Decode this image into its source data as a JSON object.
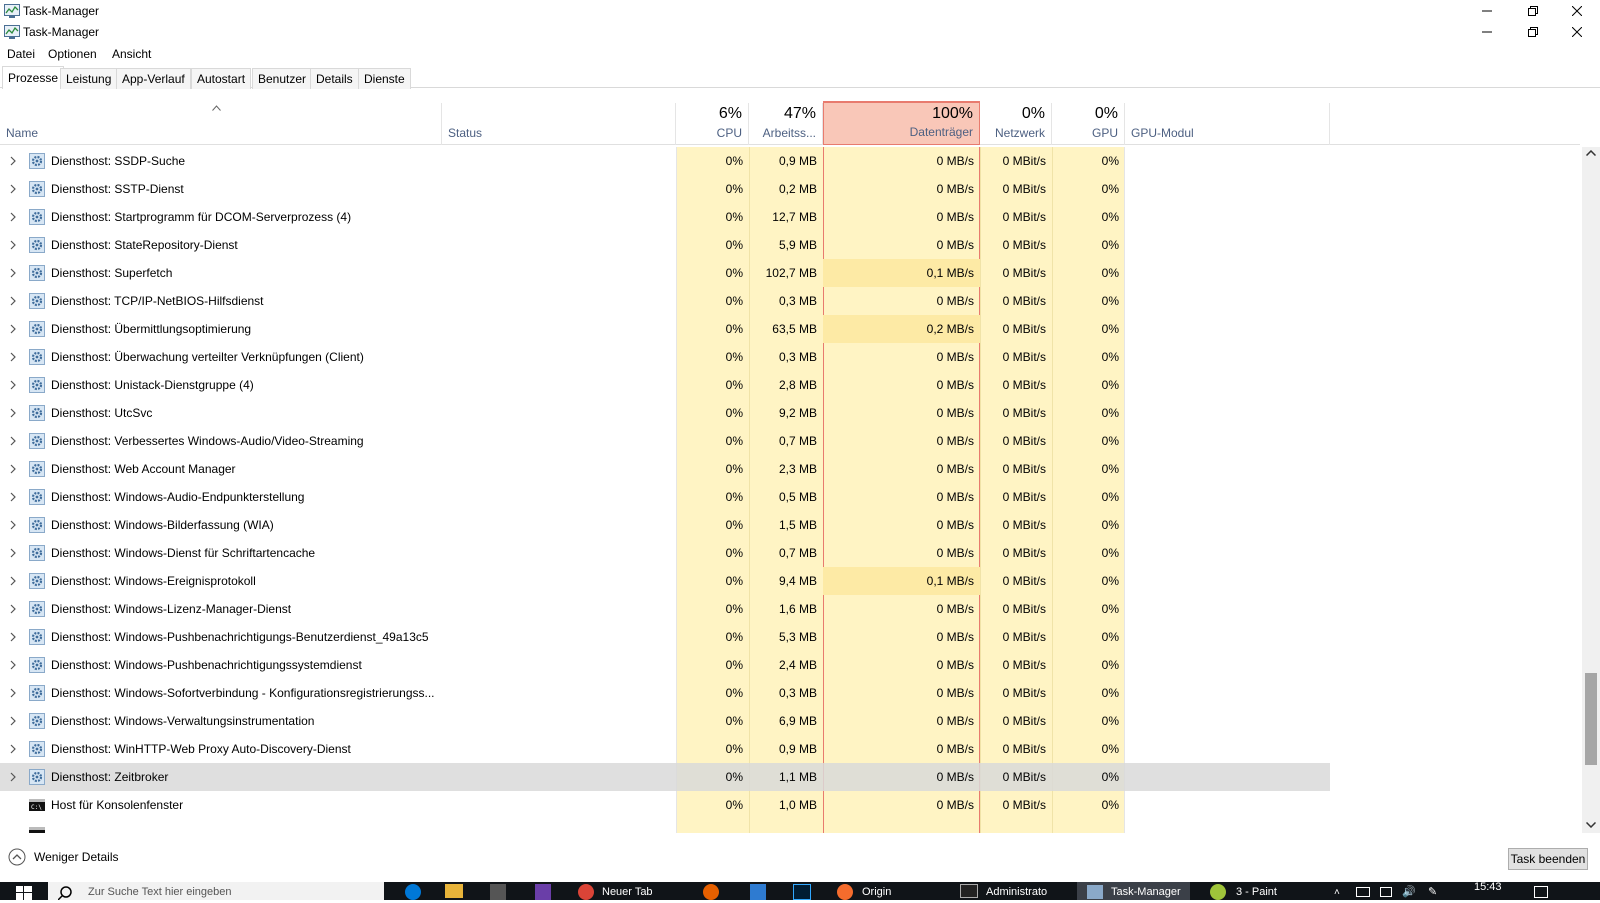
{
  "window": {
    "title": "Task-Manager"
  },
  "menu": [
    "Datei",
    "Optionen",
    "Ansicht"
  ],
  "tabs": [
    "Prozesse",
    "Leistung",
    "App-Verlauf",
    "Autostart",
    "Benutzer",
    "Details",
    "Dienste"
  ],
  "columns": {
    "name": "Name",
    "status": "Status",
    "cpu": {
      "pct": "6%",
      "label": "CPU"
    },
    "mem": {
      "pct": "47%",
      "label": "Arbeitss..."
    },
    "disk": {
      "pct": "100%",
      "label": "Datenträger"
    },
    "net": {
      "pct": "0%",
      "label": "Netzwerk"
    },
    "gpu": {
      "pct": "0%",
      "label": "GPU"
    },
    "gpumod": "GPU-Modul"
  },
  "rows": [
    {
      "name": "Diensthost: SSDP-Suche",
      "cpu": "0%",
      "mem": "0,9 MB",
      "disk": "0 MB/s",
      "net": "0 MBit/s",
      "gpu": "0%"
    },
    {
      "name": "Diensthost: SSTP-Dienst",
      "cpu": "0%",
      "mem": "0,2 MB",
      "disk": "0 MB/s",
      "net": "0 MBit/s",
      "gpu": "0%"
    },
    {
      "name": "Diensthost: Startprogramm für DCOM-Serverprozess (4)",
      "cpu": "0%",
      "mem": "12,7 MB",
      "disk": "0 MB/s",
      "net": "0 MBit/s",
      "gpu": "0%"
    },
    {
      "name": "Diensthost: StateRepository-Dienst",
      "cpu": "0%",
      "mem": "5,9 MB",
      "disk": "0 MB/s",
      "net": "0 MBit/s",
      "gpu": "0%"
    },
    {
      "name": "Diensthost: Superfetch",
      "cpu": "0%",
      "mem": "102,7 MB",
      "disk": "0,1 MB/s",
      "net": "0 MBit/s",
      "gpu": "0%"
    },
    {
      "name": "Diensthost: TCP/IP-NetBIOS-Hilfsdienst",
      "cpu": "0%",
      "mem": "0,3 MB",
      "disk": "0 MB/s",
      "net": "0 MBit/s",
      "gpu": "0%"
    },
    {
      "name": "Diensthost: Übermittlungsoptimierung",
      "cpu": "0%",
      "mem": "63,5 MB",
      "disk": "0,2 MB/s",
      "net": "0 MBit/s",
      "gpu": "0%"
    },
    {
      "name": "Diensthost: Überwachung verteilter Verknüpfungen (Client)",
      "cpu": "0%",
      "mem": "0,3 MB",
      "disk": "0 MB/s",
      "net": "0 MBit/s",
      "gpu": "0%"
    },
    {
      "name": "Diensthost: Unistack-Dienstgruppe (4)",
      "cpu": "0%",
      "mem": "2,8 MB",
      "disk": "0 MB/s",
      "net": "0 MBit/s",
      "gpu": "0%"
    },
    {
      "name": "Diensthost: UtcSvc",
      "cpu": "0%",
      "mem": "9,2 MB",
      "disk": "0 MB/s",
      "net": "0 MBit/s",
      "gpu": "0%"
    },
    {
      "name": "Diensthost: Verbessertes Windows-Audio/Video-Streaming",
      "cpu": "0%",
      "mem": "0,7 MB",
      "disk": "0 MB/s",
      "net": "0 MBit/s",
      "gpu": "0%"
    },
    {
      "name": "Diensthost: Web Account Manager",
      "cpu": "0%",
      "mem": "2,3 MB",
      "disk": "0 MB/s",
      "net": "0 MBit/s",
      "gpu": "0%"
    },
    {
      "name": "Diensthost: Windows-Audio-Endpunkterstellung",
      "cpu": "0%",
      "mem": "0,5 MB",
      "disk": "0 MB/s",
      "net": "0 MBit/s",
      "gpu": "0%"
    },
    {
      "name": "Diensthost: Windows-Bilderfassung (WIA)",
      "cpu": "0%",
      "mem": "1,5 MB",
      "disk": "0 MB/s",
      "net": "0 MBit/s",
      "gpu": "0%"
    },
    {
      "name": "Diensthost: Windows-Dienst für Schriftartencache",
      "cpu": "0%",
      "mem": "0,7 MB",
      "disk": "0 MB/s",
      "net": "0 MBit/s",
      "gpu": "0%"
    },
    {
      "name": "Diensthost: Windows-Ereignisprotokoll",
      "cpu": "0%",
      "mem": "9,4 MB",
      "disk": "0,1 MB/s",
      "net": "0 MBit/s",
      "gpu": "0%"
    },
    {
      "name": "Diensthost: Windows-Lizenz-Manager-Dienst",
      "cpu": "0%",
      "mem": "1,6 MB",
      "disk": "0 MB/s",
      "net": "0 MBit/s",
      "gpu": "0%"
    },
    {
      "name": "Diensthost: Windows-Pushbenachrichtigungs-Benutzerdienst_49a13c5",
      "cpu": "0%",
      "mem": "5,3 MB",
      "disk": "0 MB/s",
      "net": "0 MBit/s",
      "gpu": "0%"
    },
    {
      "name": "Diensthost: Windows-Pushbenachrichtigungssystemdienst",
      "cpu": "0%",
      "mem": "2,4 MB",
      "disk": "0 MB/s",
      "net": "0 MBit/s",
      "gpu": "0%"
    },
    {
      "name": "Diensthost: Windows-Sofortverbindung - Konfigurationsregistrierungss...",
      "cpu": "0%",
      "mem": "0,3 MB",
      "disk": "0 MB/s",
      "net": "0 MBit/s",
      "gpu": "0%"
    },
    {
      "name": "Diensthost: Windows-Verwaltungsinstrumentation",
      "cpu": "0%",
      "mem": "6,9 MB",
      "disk": "0 MB/s",
      "net": "0 MBit/s",
      "gpu": "0%"
    },
    {
      "name": "Diensthost: WinHTTP-Web Proxy Auto-Discovery-Dienst",
      "cpu": "0%",
      "mem": "0,9 MB",
      "disk": "0 MB/s",
      "net": "0 MBit/s",
      "gpu": "0%"
    },
    {
      "name": "Diensthost: Zeitbroker",
      "cpu": "0%",
      "mem": "1,1 MB",
      "disk": "0 MB/s",
      "net": "0 MBit/s",
      "gpu": "0%",
      "selected": true
    },
    {
      "name": "Host für Konsolenfenster",
      "cpu": "0%",
      "mem": "1,0 MB",
      "disk": "0 MB/s",
      "net": "0 MBit/s",
      "gpu": "0%",
      "console": true
    }
  ],
  "footer": {
    "fewer": "Weniger Details",
    "end_task": "Task beenden"
  },
  "taskbar": {
    "search": "Zur Suche Text hier eingeben",
    "items": [
      "Neuer Tab",
      "Origin",
      "Administrato",
      "Task-Manager",
      "3 - Paint"
    ],
    "time": "15:43"
  },
  "colors": {
    "cpu_bg": "#fff4c4",
    "mem_bg": "#fff4c4",
    "disk_bg": "#fff4c4",
    "disk_hot": "#fdeaa5",
    "disk_head": "#f9c7b8",
    "sel": "#d9d9d9"
  }
}
